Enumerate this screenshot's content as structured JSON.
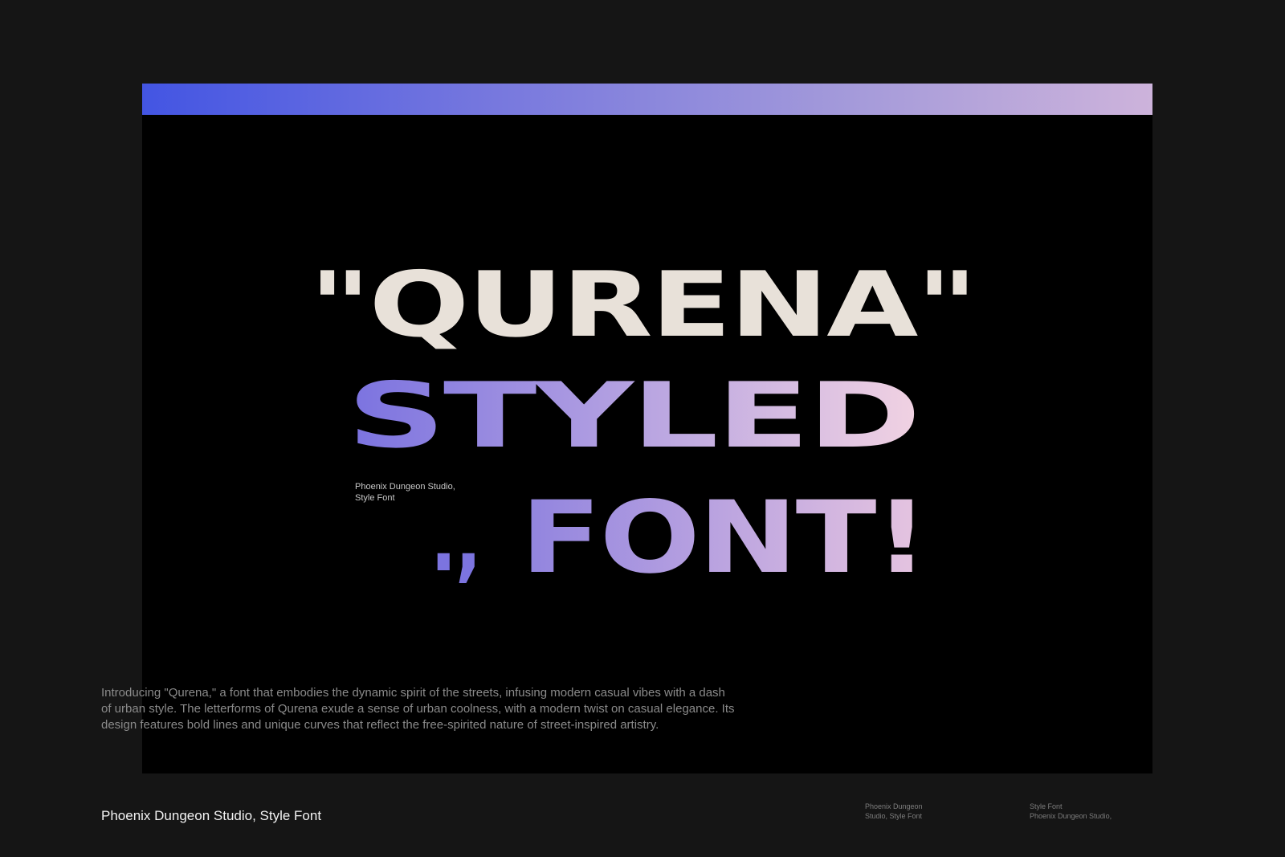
{
  "headline": {
    "line1": "\"QURENA\"",
    "line2": "STYLED",
    "line3_punct": ".,",
    "line3_word": "FONT!"
  },
  "caption": {
    "line1": "Phoenix Dungeon Studio,",
    "line2": "Style Font"
  },
  "description": {
    "line1": "Introducing \"Qurena,\" a font that embodies the dynamic spirit of the streets, infusing modern casual vibes with a dash",
    "line2": "of urban style. The letterforms of Qurena exude a sense of urban coolness, with a modern twist on casual elegance. Its",
    "line3": "design features bold lines and unique curves that reflect the free-spirited nature of street-inspired artistry."
  },
  "footer": {
    "title": "Phoenix Dungeon Studio, Style Font",
    "meta1": {
      "line1": "Phoenix Dungeon",
      "line2": "Studio, Style Font"
    },
    "meta2": {
      "line1": "Style Font",
      "line2": "Phoenix Dungeon Studio,"
    }
  },
  "colors": {
    "page_background": "#151515",
    "panel_background": "#000000",
    "accent_bar_start": "#4355e3",
    "accent_bar_end": "#cdb3db",
    "headline_cream": "#e8e1d9",
    "gradient_violet": "#7a72e0",
    "gradient_pink": "#f2d3e2"
  }
}
